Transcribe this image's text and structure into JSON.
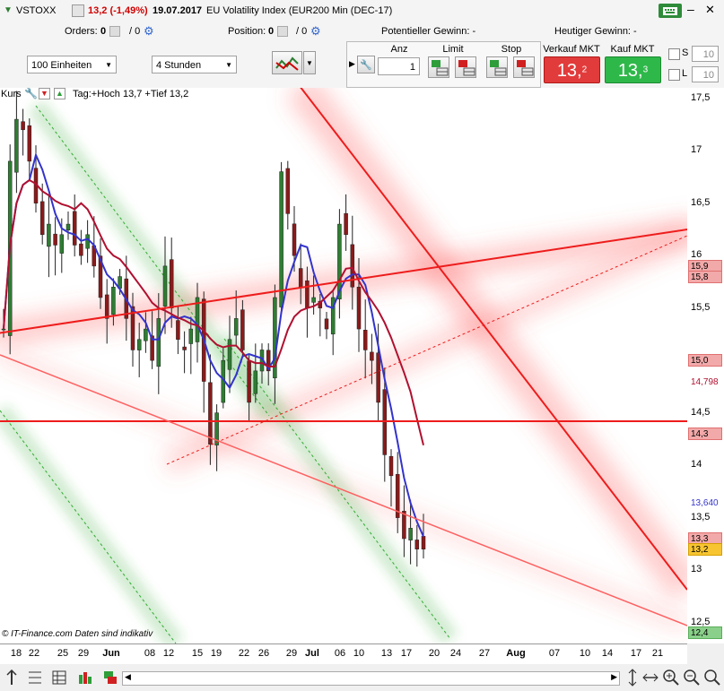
{
  "header": {
    "symbol": "VSTOXX",
    "change": "13,2 (-1,49%)",
    "date": "19.07.2017",
    "instrument": "EU Volatility Index (EUR200 Min (DEC-17)"
  },
  "row2": {
    "orders_label": "Orders:",
    "orders_value": "0",
    "orders_value2": "/ 0",
    "position_label": "Position:",
    "position_value": "0",
    "position_value2": "/ 0",
    "potential_gain": "Potentieller Gewinn:  -",
    "today_gain": "Heutiger Gewinn:  -"
  },
  "toolbar": {
    "units_select": "100 Einheiten",
    "interval_select": "4 Stunden",
    "anz_label": "Anz",
    "anz_value": "1",
    "limit_label": "Limit",
    "stop_label": "Stop",
    "sell_label": "Verkauf MKT",
    "sell_price_main": "13,",
    "sell_price_sup": "2",
    "buy_label": "Kauf MKT",
    "buy_price_main": "13,",
    "buy_price_sup": "3",
    "s_label": "S",
    "s_value": "10",
    "l_label": "L",
    "l_value": "10"
  },
  "chart_header": {
    "kurs_label": "Kurs",
    "info": "Tag:+Hoch 13,7 +Tief 13,2"
  },
  "chart_footer": {
    "source": "© IT-Finance.com",
    "disclaimer": "Daten sind indikativ"
  },
  "colors": {
    "candle_up": "#2e7d32",
    "candle_down": "#8b1a1a",
    "ma_fast": "#3333cc",
    "ma_slow": "#b01030",
    "trendline_red": "#ee1c1c",
    "channel_green": "#33aa33",
    "sell": "#e23b3b",
    "buy": "#2fb84a"
  },
  "chart_data": {
    "type": "candlestick",
    "ylim": [
      12.3,
      17.6
    ],
    "y_ticks": [
      "17,5",
      "17",
      "16,5",
      "16",
      "15,5",
      "15",
      "14,5",
      "14",
      "13,5",
      "13",
      "12,5"
    ],
    "x_ticks": [
      "18",
      "22",
      "25",
      "29",
      "Jun",
      "08",
      "12",
      "15",
      "19",
      "22",
      "26",
      "29",
      "Jul",
      "06",
      "10",
      "13",
      "17",
      "20",
      "24",
      "27",
      "Aug",
      "07",
      "10",
      "14",
      "17",
      "21"
    ],
    "price_labels": [
      {
        "text": "15,9",
        "value": 15.9,
        "style": "red"
      },
      {
        "text": "15,8",
        "value": 15.8,
        "style": "red"
      },
      {
        "text": "15,0",
        "value": 15.0,
        "style": "red"
      },
      {
        "text": "14,798",
        "value": 14.798,
        "style": "darkred"
      },
      {
        "text": "14,3",
        "value": 14.3,
        "style": "red"
      },
      {
        "text": "13,640",
        "value": 13.64,
        "style": "blue"
      },
      {
        "text": "13,3",
        "value": 13.3,
        "style": "red"
      },
      {
        "text": "13,2",
        "value": 13.2,
        "style": "yellow"
      },
      {
        "text": "12,4",
        "value": 12.4,
        "style": "green"
      }
    ],
    "close_series": [
      15.3,
      16.9,
      17.3,
      17.2,
      16.9,
      16.5,
      16.2,
      16.3,
      16.1,
      16.2,
      16.3,
      16.1,
      16.0,
      16.2,
      15.9,
      15.6,
      15.4,
      15.7,
      15.8,
      15.4,
      15.1,
      15.2,
      15.3,
      15.0,
      15.4,
      15.9,
      15.5,
      15.2,
      15.1,
      15.3,
      15.6,
      14.8,
      14.2,
      14.5,
      15.0,
      15.2,
      15.4,
      15.1,
      14.6,
      14.9,
      15.1,
      14.9,
      15.6,
      16.8,
      16.4,
      16.0,
      15.7,
      15.5,
      15.6,
      15.5,
      15.3,
      15.6,
      16.3,
      16.2,
      15.7,
      15.3,
      15.1,
      15.0,
      14.6,
      14.1,
      13.9,
      13.5,
      13.3,
      13.4,
      13.2,
      13.2
    ]
  }
}
